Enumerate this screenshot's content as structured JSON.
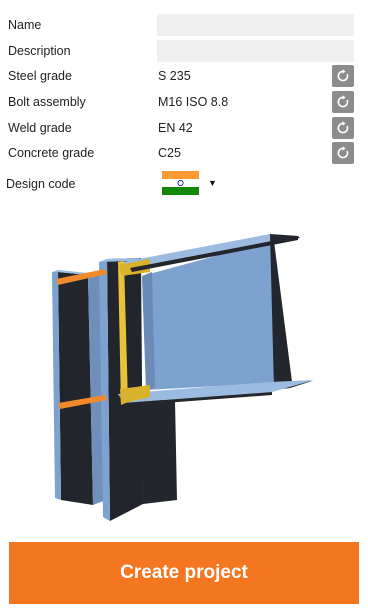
{
  "form": {
    "name": {
      "label": "Name",
      "value": ""
    },
    "description": {
      "label": "Description",
      "value": ""
    },
    "steel_grade": {
      "label": "Steel grade",
      "value": "S 235"
    },
    "bolt_assembly": {
      "label": "Bolt assembly",
      "value": "M16 ISO 8.8"
    },
    "weld_grade": {
      "label": "Weld grade",
      "value": "EN 42"
    },
    "concrete_grade": {
      "label": "Concrete grade",
      "value": "C25"
    },
    "design_code": {
      "label": "Design code",
      "flag_icon": "india-flag-icon",
      "dropdown_icon": "caret-down-icon"
    }
  },
  "icons": {
    "reset": "reset-icon"
  },
  "preview": {
    "description_icon": "steel-connection-3d-model"
  },
  "actions": {
    "create_label": "Create project"
  },
  "colors": {
    "accent": "#f47621",
    "reset_button": "#8c8c8c",
    "input_bg": "#f0f0f0",
    "steel_blue": "#7ea2cf",
    "steel_dark": "#23272d"
  }
}
